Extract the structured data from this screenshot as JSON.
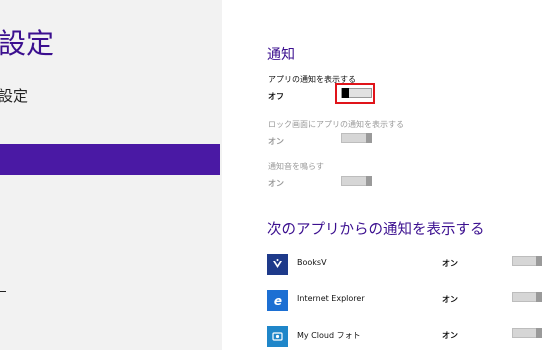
{
  "left": {
    "title": "設定",
    "subtitle": "設定",
    "dash": "–"
  },
  "notifications": {
    "section_title": "通知",
    "settings": [
      {
        "label": "アプリの通知を表示する",
        "state": "オフ",
        "enabled": true
      },
      {
        "label": "ロック画面にアプリの通知を表示する",
        "state": "オン",
        "enabled": false
      },
      {
        "label": "通知音を鳴らす",
        "state": "オン",
        "enabled": false
      }
    ]
  },
  "apps_section": {
    "title": "次のアプリからの通知を表示する",
    "apps": [
      {
        "name": "BooksV",
        "state": "オン",
        "icon": "booksv-icon",
        "color": "#1e3a8a"
      },
      {
        "name": "Internet Explorer",
        "state": "オン",
        "icon": "internet-explorer-icon",
        "color": "#1c6fd3"
      },
      {
        "name": "My Cloud フォト",
        "state": "オン",
        "icon": "cloud-photo-icon",
        "color": "#1f86c9"
      }
    ]
  },
  "colors": {
    "accent": "#4a19a4",
    "title": "#3b0f8f",
    "highlight": "#e0141a"
  }
}
